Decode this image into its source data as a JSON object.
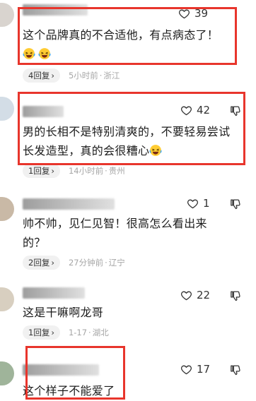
{
  "comments": [
    {
      "likes": "39",
      "text": "这个品牌真的不合适他，有点病态了！",
      "emoji_count": 2,
      "reply_label": "4回复",
      "time": "5小时前",
      "location": "浙江"
    },
    {
      "likes": "42",
      "text": "男的长相不是特别清爽的，不要轻易尝试长发造型，真的会很糟心",
      "emoji_count": 1,
      "reply_label": "1回复",
      "time": "14小时前",
      "location": "贵州"
    },
    {
      "likes": "1",
      "text": "帅不帅，见仁见智！很高怎么看出来的？",
      "emoji_count": 0,
      "reply_label": "2回复",
      "time": "27分钟前",
      "location": "辽宁"
    },
    {
      "likes": "22",
      "text": "这是干嘛啊龙哥",
      "emoji_count": 0,
      "reply_label": "1回复",
      "time": "1-17",
      "location": "湖北"
    },
    {
      "likes": "17",
      "text": "这个样子不能爱了",
      "emoji_count": 0,
      "reply_label": "",
      "time": "",
      "location": ""
    }
  ],
  "icons": {
    "like": "heart-outline-icon",
    "dislike": "thumbs-down-icon",
    "reply_arrow": "chevron-right-icon",
    "emoji": "laughing-crying-emoji"
  },
  "colors": {
    "highlight_box": "#e8352c",
    "meta_text": "#a6a6a6",
    "body_text": "#1c1c1c"
  }
}
